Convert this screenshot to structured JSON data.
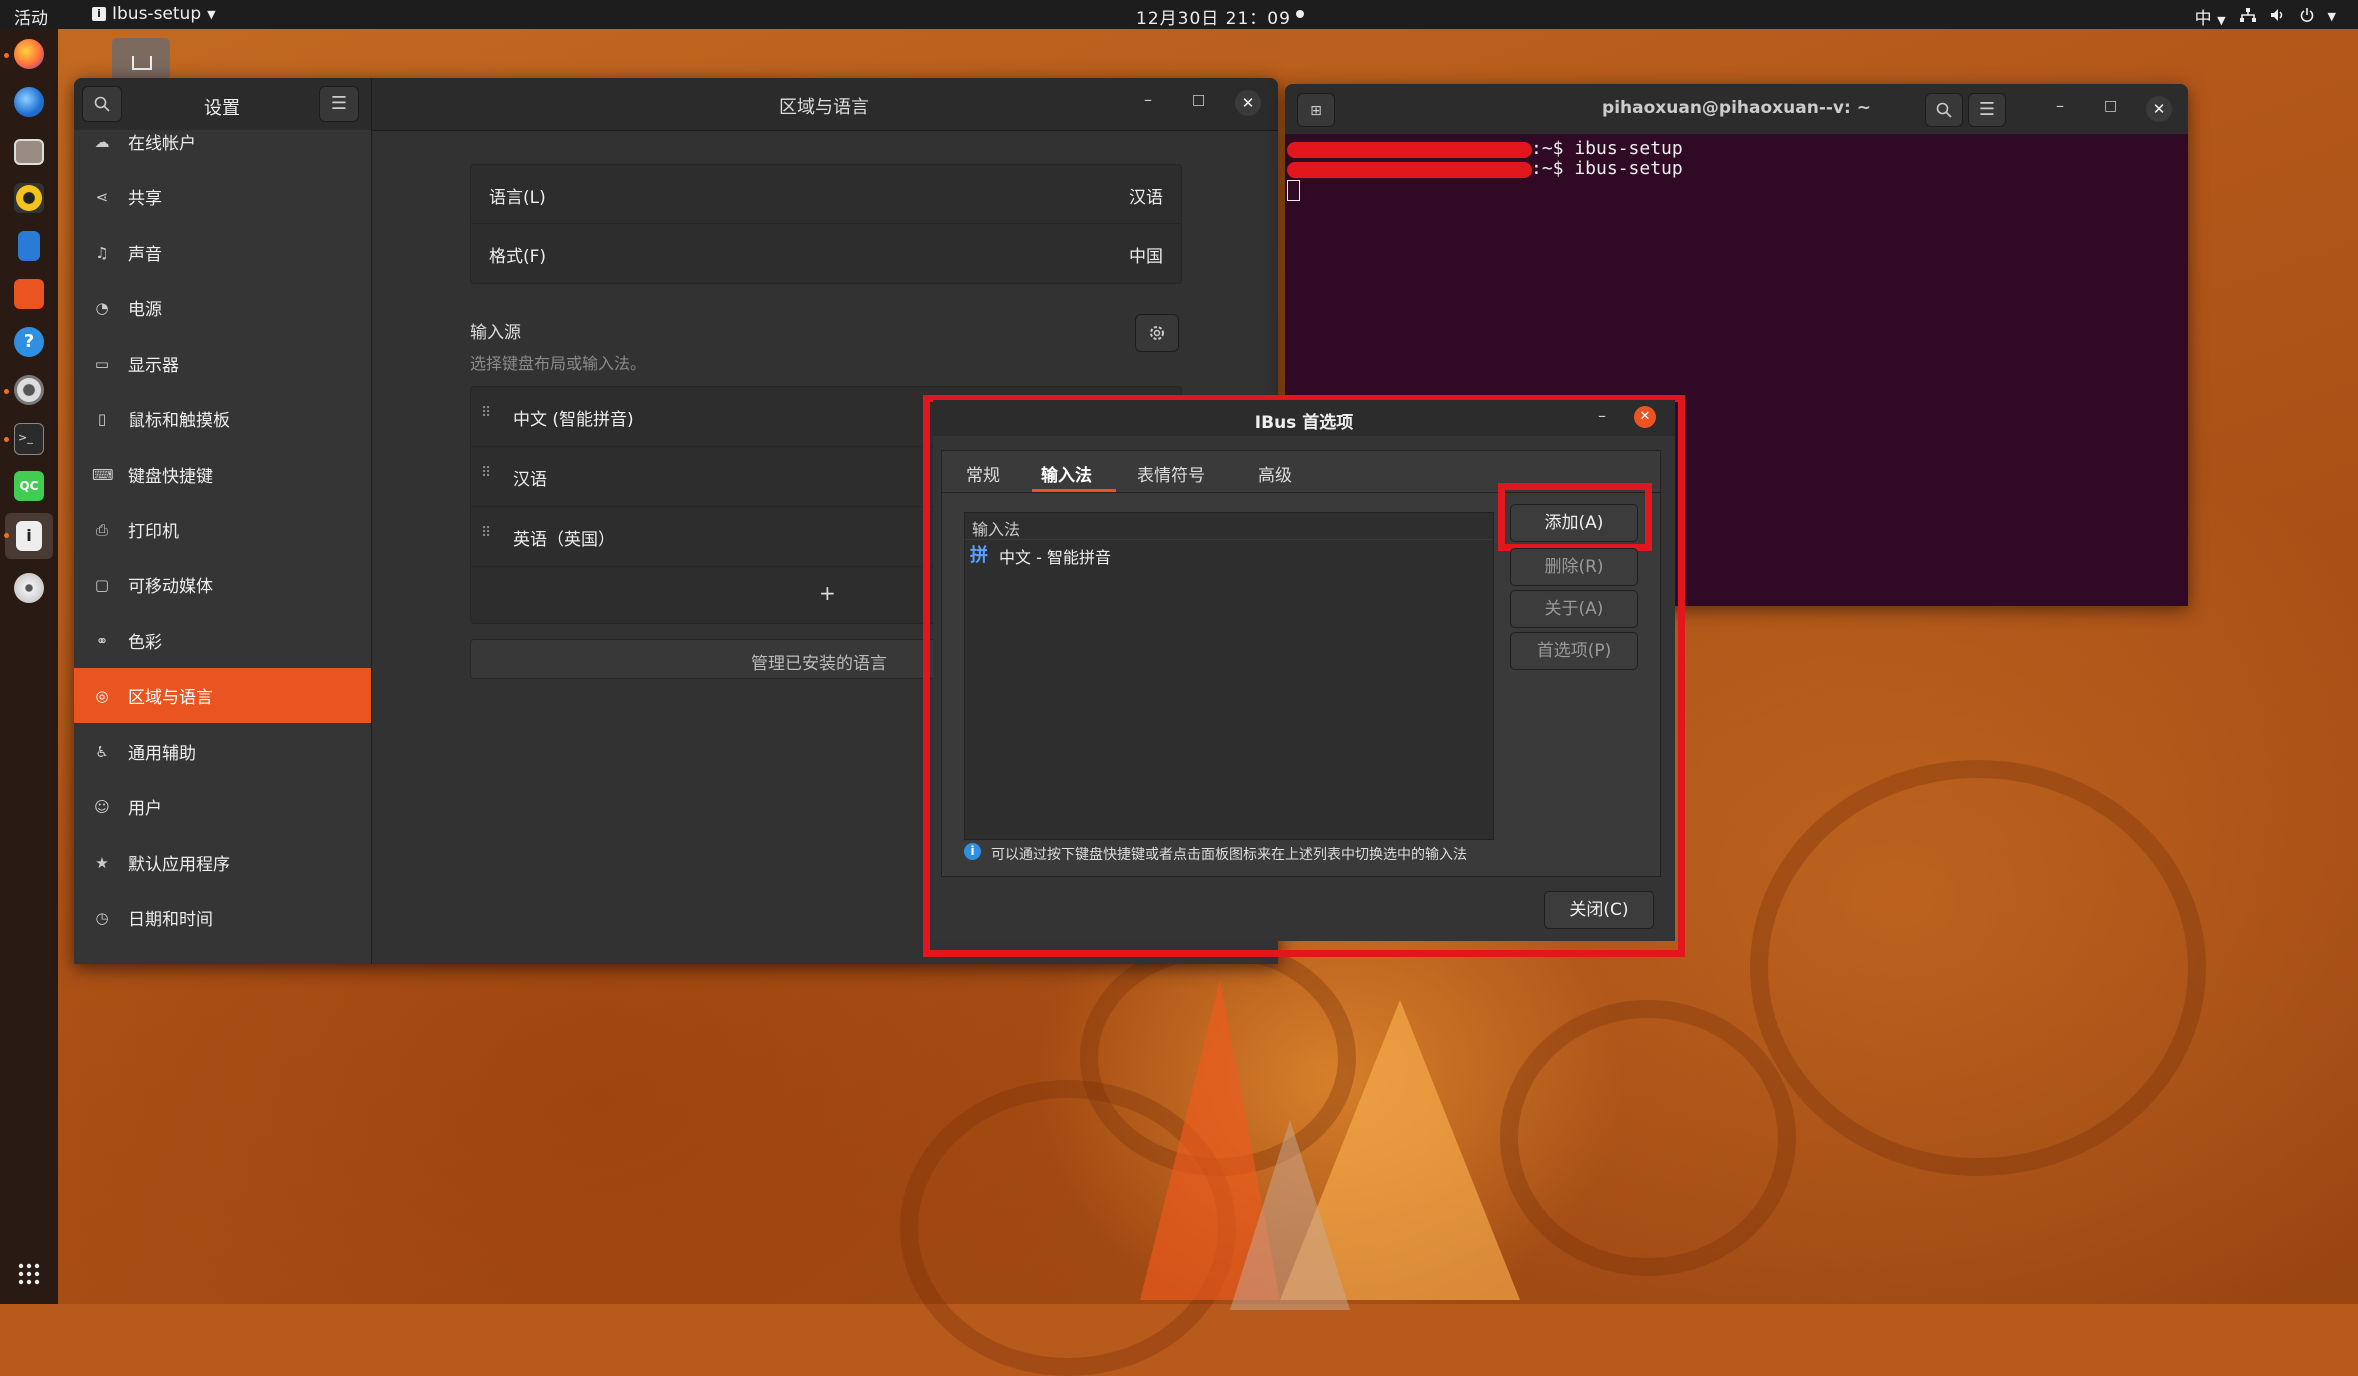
{
  "topbar": {
    "activities": "活动",
    "app_menu": "Ibus-setup",
    "app_icon": "i",
    "clock": "12月30日 21：09",
    "input_method_indicator": "中",
    "tray_icons": [
      "network-icon",
      "volume-icon",
      "power-icon"
    ]
  },
  "dock": {
    "apps": [
      "firefox-icon",
      "thunderbird-icon",
      "files-icon",
      "rhythmbox-icon",
      "writer-icon",
      "software-icon",
      "help-icon",
      "settings-icon",
      "terminal-icon",
      "qt-creator-icon",
      "ibus-icon",
      "dvd-icon"
    ],
    "show_apps": "show-applications-icon"
  },
  "settings": {
    "sidebar_title": "设置",
    "main_title": "区域与语言",
    "sidebar_items": [
      {
        "label": "在线帐户",
        "icon": "cloud-icon"
      },
      {
        "label": "共享",
        "icon": "share-icon"
      },
      {
        "label": "声音",
        "icon": "music-note-icon"
      },
      {
        "label": "电源",
        "icon": "power-icon"
      },
      {
        "label": "显示器",
        "icon": "display-icon"
      },
      {
        "label": "鼠标和触摸板",
        "icon": "mouse-icon"
      },
      {
        "label": "键盘快捷键",
        "icon": "keyboard-icon"
      },
      {
        "label": "打印机",
        "icon": "printer-icon"
      },
      {
        "label": "可移动媒体",
        "icon": "removable-media-icon"
      },
      {
        "label": "色彩",
        "icon": "color-icon"
      },
      {
        "label": "区域与语言",
        "icon": "globe-icon"
      },
      {
        "label": "通用辅助",
        "icon": "accessibility-icon"
      },
      {
        "label": "用户",
        "icon": "user-icon"
      },
      {
        "label": "默认应用程序",
        "icon": "star-icon"
      },
      {
        "label": "日期和时间",
        "icon": "clock-icon"
      }
    ],
    "language_label": "语言(L)",
    "language_value": "汉语",
    "format_label": "格式(F)",
    "format_value": "中国",
    "input_sources_heading": "输入源",
    "input_sources_hint": "选择键盘布局或输入法。",
    "input_sources": [
      "中文 (智能拼音)",
      "汉语",
      "英语（英国）"
    ],
    "add_symbol": "+",
    "manage_languages": "管理已安装的语言"
  },
  "terminal": {
    "title": "pihaoxuan@pihaoxuan--v: ~",
    "lines": [
      ":~$ ibus-setup",
      ":~$ ibus-setup"
    ]
  },
  "ibus": {
    "title": "IBus 首选项",
    "tabs": [
      "常规",
      "输入法",
      "表情符号",
      "高级"
    ],
    "active_tab": "输入法",
    "list_header": "输入法",
    "list_items": [
      {
        "badge": "拼",
        "label": "中文 - 智能拼音"
      }
    ],
    "buttons": {
      "add": "添加(A)",
      "remove": "删除(R)",
      "about": "关于(A)",
      "preferences": "首选项(P)",
      "close": "关闭(C)"
    },
    "info": "可以通过按下键盘快捷键或者点击面板图标来在上述列表中切换选中的输入法"
  },
  "colors": {
    "accent": "#e95420",
    "highlight": "#e2171d",
    "terminal_bg": "#300a24"
  }
}
